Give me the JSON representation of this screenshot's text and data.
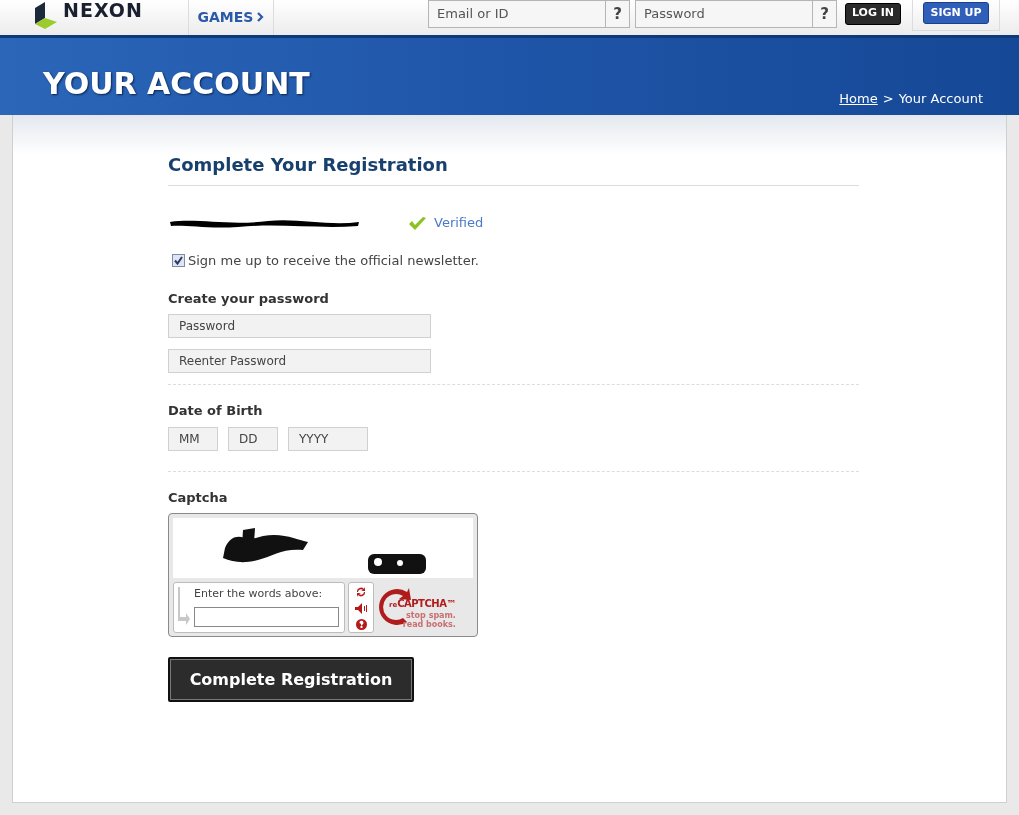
{
  "header": {
    "logo": "NEXON",
    "games_menu": "GAMES",
    "email_field": {
      "placeholder": "Email or ID"
    },
    "email_help": "?",
    "password_field": {
      "placeholder": "Password"
    },
    "password_help": "?",
    "login_button": "LOG IN",
    "signup_button": "SIGN UP"
  },
  "banner": {
    "title": "YOUR ACCOUNT",
    "breadcrumb": [
      {
        "label": "Home",
        "link": true
      },
      {
        "label": "Your Account",
        "link": false
      }
    ],
    "separator": ">"
  },
  "form": {
    "heading": "Complete Your Registration",
    "verified": "Verified",
    "newsletter": {
      "label": "Sign me up to receive the official newsletter.",
      "checked": true
    },
    "password_section": {
      "label": "Create your password",
      "fields": [
        {
          "placeholder": "Password"
        },
        {
          "placeholder": "Reenter Password"
        }
      ]
    },
    "dob_section": {
      "label": "Date of Birth",
      "fields": [
        {
          "placeholder": "MM"
        },
        {
          "placeholder": "DD"
        },
        {
          "placeholder": "YYYY"
        }
      ]
    },
    "captcha": {
      "label": "Captcha",
      "prompt": "Enter the words above:",
      "brand": "CAPTCHA™",
      "brand_prefix": "re",
      "tagline_1": "stop spam.",
      "tagline_2": "read books."
    },
    "submit": "Complete Registration"
  }
}
